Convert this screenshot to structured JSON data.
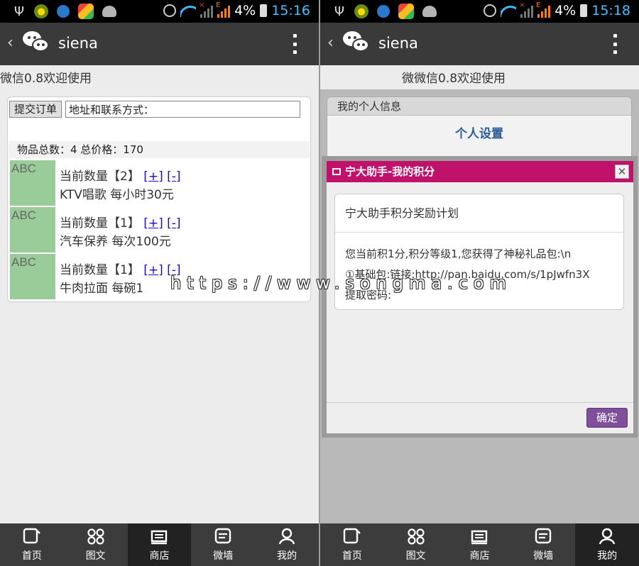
{
  "left": {
    "status_bar": {
      "battery": "4%",
      "time": "15:16"
    },
    "action_bar": {
      "back": "‹",
      "title": "siena"
    },
    "welcome": "微信0.8欢迎使用",
    "cart": {
      "submit_label": "提交订单",
      "address_value": "地址和联系方式：",
      "summary": "物品总数：4 总价格：170",
      "items": [
        {
          "img_label": "ABC",
          "qty_text": "当前数量【2】",
          "plus": "[+]",
          "minus": "[-]",
          "desc": "KTV唱歌 每小时30元"
        },
        {
          "img_label": "ABC",
          "qty_text": "当前数量【1】",
          "plus": "[+]",
          "minus": "[-]",
          "desc": "汽车保养 每次100元"
        },
        {
          "img_label": "ABC",
          "qty_text": "当前数量【1】",
          "plus": "[+]",
          "minus": "[-]",
          "desc": "牛肉拉面 每碗1"
        }
      ]
    },
    "nav_active": "商店"
  },
  "right": {
    "status_bar": {
      "battery": "4%",
      "time": "15:18"
    },
    "action_bar": {
      "back": "‹",
      "title": "siena"
    },
    "welcome": "微微信0.8欢迎使用",
    "info_card": {
      "header": "我的个人信息",
      "button": "个人设置"
    },
    "dialog": {
      "title": "宁大助手-我的积分",
      "close": "✕",
      "box_title": "宁大助手积分奖励计划",
      "line1": "您当前积1分,积分等级1,您获得了神秘礼品包:\\n",
      "line2": "①基础包:链接:http://pan.baidu.com/s/1pJwfn3X",
      "line3": "提取密码:",
      "ok": "确定"
    },
    "nav_active": "我的"
  },
  "bottom_nav": [
    {
      "label": "首页",
      "icon": "home-icon"
    },
    {
      "label": "图文",
      "icon": "grid-icon"
    },
    {
      "label": "商店",
      "icon": "shop-icon"
    },
    {
      "label": "微墙",
      "icon": "wall-icon"
    },
    {
      "label": "我的",
      "icon": "user-icon"
    }
  ],
  "watermark": "https://www.songma.com"
}
